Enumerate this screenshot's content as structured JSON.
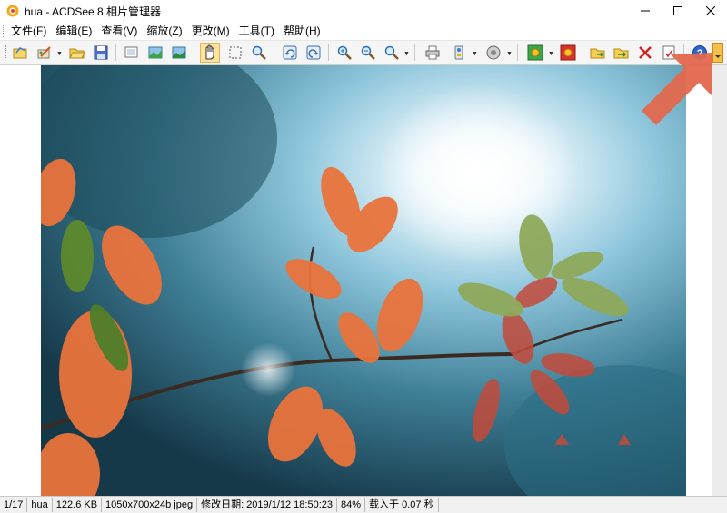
{
  "window": {
    "title": "hua - ACDSee 8 相片管理器",
    "icon": "acdsee-app-icon",
    "controls": [
      "minimize-icon",
      "maximize-icon",
      "close-icon"
    ]
  },
  "menu": {
    "items": [
      {
        "label": "文件(F)",
        "name": "menu-file"
      },
      {
        "label": "编辑(E)",
        "name": "menu-edit"
      },
      {
        "label": "查看(V)",
        "name": "menu-view"
      },
      {
        "label": "缩放(Z)",
        "name": "menu-zoom"
      },
      {
        "label": "更改(M)",
        "name": "menu-modify"
      },
      {
        "label": "工具(T)",
        "name": "menu-tools"
      },
      {
        "label": "帮助(H)",
        "name": "menu-help"
      }
    ]
  },
  "toolbar": {
    "buttons": [
      "browse-icon",
      "edit-icon",
      "open-folder-icon",
      "save-icon",
      "properties-icon",
      "previous-image-icon",
      "next-image-icon",
      "hand-tool-icon",
      "select-tool-icon",
      "magnifier-icon",
      "rotate-left-icon",
      "rotate-right-icon",
      "zoom-in-icon",
      "zoom-out-icon",
      "zoom-menu-icon",
      "print-icon",
      "acquire-icon",
      "slideshow-audio-icon",
      "wallpaper-center-icon",
      "wallpaper-tile-icon",
      "copy-to-folder-icon",
      "move-to-folder-icon",
      "delete-icon",
      "fix-image-icon",
      "help-icon",
      "toolbar-overflow-icon"
    ],
    "active": "hand-tool-icon"
  },
  "annotation": {
    "arrow_color": "#e2684d",
    "points_to": "toolbar-overflow-icon"
  },
  "statusbar": {
    "index": "1/17",
    "filename": "hua",
    "filesize": "122.6 KB",
    "dimensions": "1050x700x24b jpeg",
    "modified": "修改日期: 2019/1/12 18:50:23",
    "zoom": "84%",
    "load_time": "载入于 0.07 秒"
  }
}
